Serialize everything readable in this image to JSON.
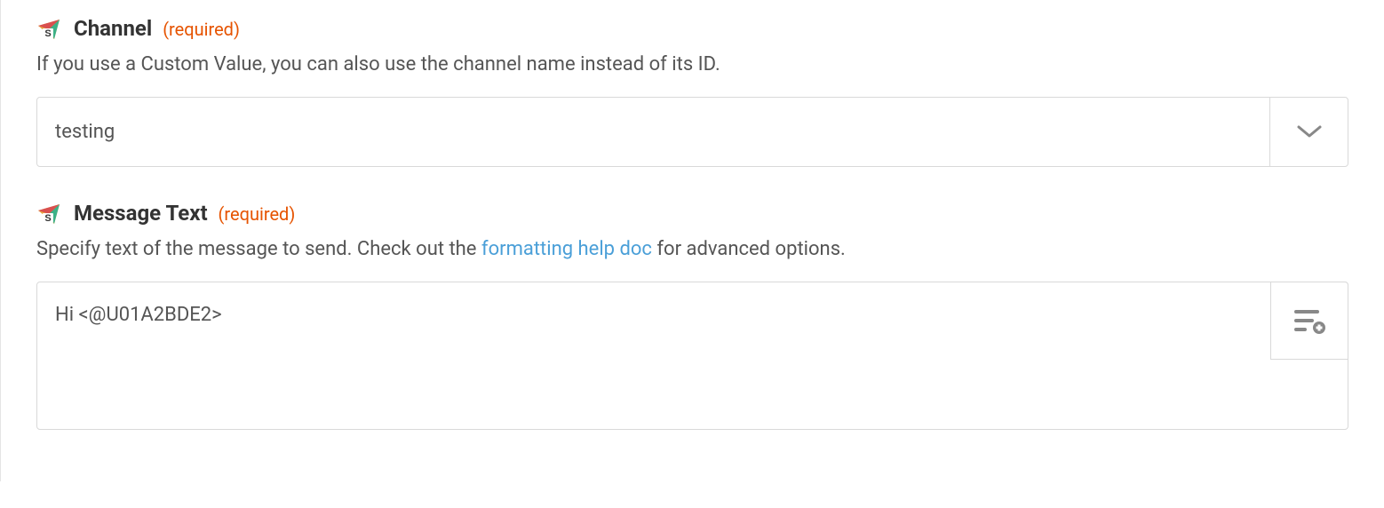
{
  "fields": {
    "channel": {
      "label": "Channel",
      "required_text": "(required)",
      "description": "If you use a Custom Value, you can also use the channel name instead of its ID.",
      "value": "testing"
    },
    "message_text": {
      "label": "Message Text",
      "required_text": "(required)",
      "description_pre": "Specify text of the message to send. Check out the ",
      "description_link": "formatting help doc",
      "description_post": " for advanced options.",
      "value": "Hi <@U01A2BDE2>"
    }
  }
}
